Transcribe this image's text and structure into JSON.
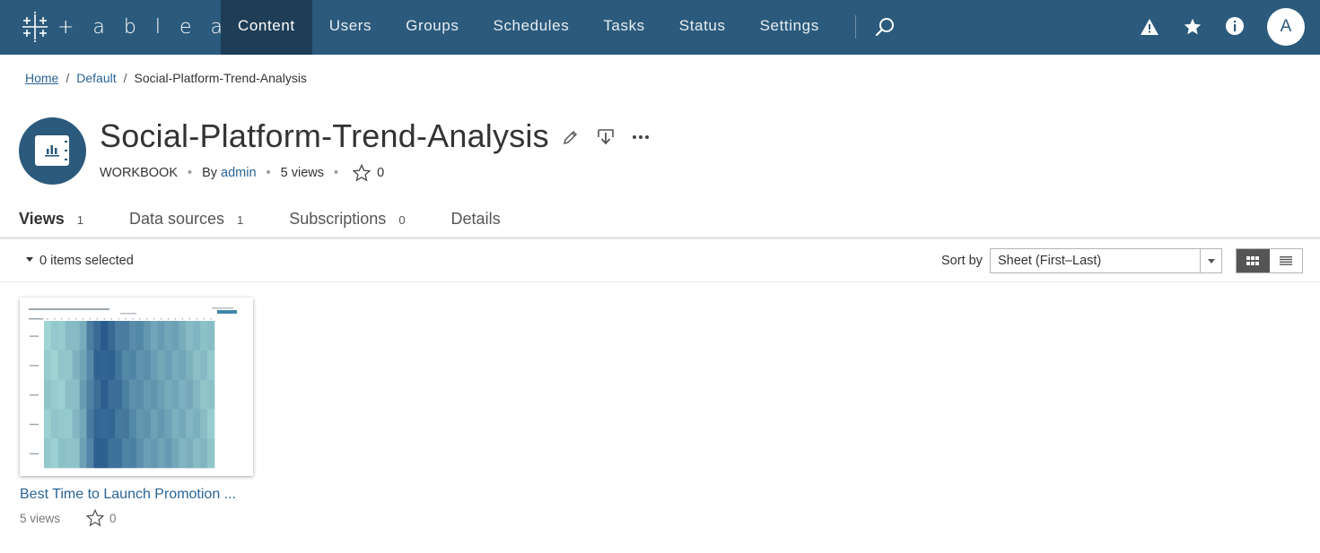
{
  "app": {
    "brand": "+ a b l e a u",
    "brand_color": "#2b5a7c"
  },
  "nav": {
    "items": [
      {
        "label": "Content",
        "active": true
      },
      {
        "label": "Users"
      },
      {
        "label": "Groups"
      },
      {
        "label": "Schedules"
      },
      {
        "label": "Tasks"
      },
      {
        "label": "Status"
      },
      {
        "label": "Settings"
      }
    ],
    "icons": [
      "search-icon",
      "alert-icon",
      "star-icon",
      "info-icon"
    ],
    "avatar_initial": "A"
  },
  "breadcrumb": {
    "home": "Home",
    "project": "Default",
    "current": "Social-Platform-Trend-Analysis"
  },
  "workbook": {
    "title": "Social-Platform-Trend-Analysis",
    "type": "WORKBOOK",
    "by_label": "By",
    "owner": "admin",
    "views": "5 views",
    "favorites": "0"
  },
  "tabs": [
    {
      "label": "Views",
      "count": "1",
      "active": true
    },
    {
      "label": "Data sources",
      "count": "1"
    },
    {
      "label": "Subscriptions",
      "count": "0"
    },
    {
      "label": "Details",
      "count": ""
    }
  ],
  "toolbar": {
    "selection": "0 items selected",
    "sort_label": "Sort by",
    "sort_value": "Sheet (First–Last)",
    "view_mode": "grid"
  },
  "views": [
    {
      "title": "Best Time to Launch Promotion ...",
      "views": "5 views",
      "favorites": "0"
    }
  ]
}
